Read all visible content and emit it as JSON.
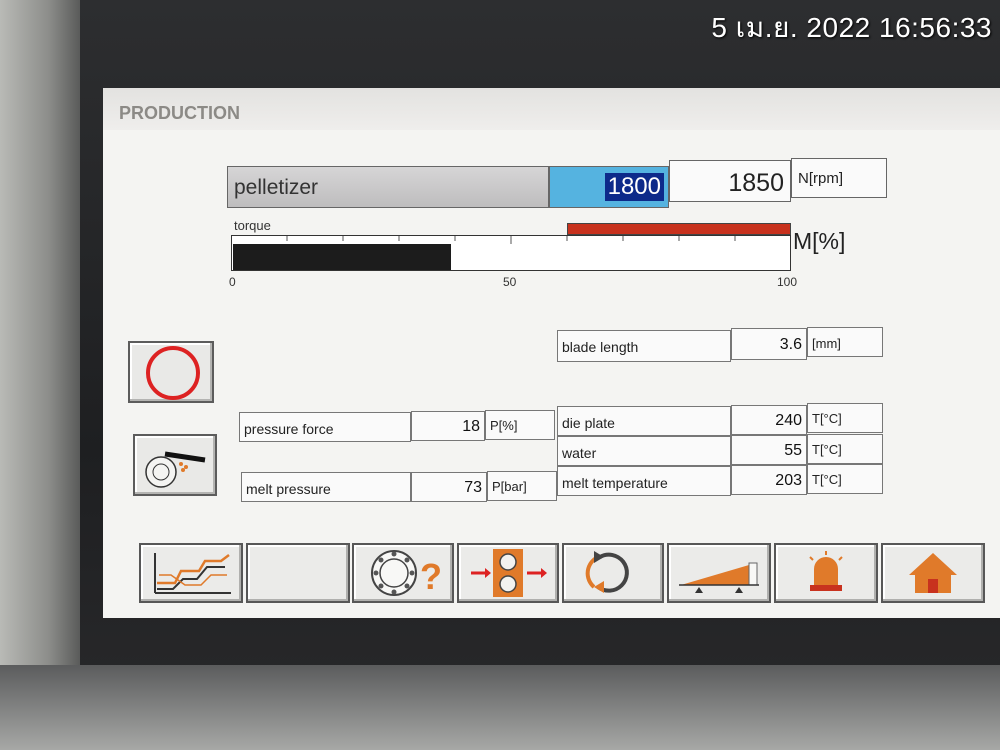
{
  "timestamp": "5 เม.ย. 2022 16:56:33",
  "screen": {
    "title": "PRODUCTION"
  },
  "pelletizer": {
    "label": "pelletizer",
    "setpoint": "1800",
    "actual": "1850",
    "unit": "N[rpm]"
  },
  "torque": {
    "label": "torque",
    "unit": "M[%]",
    "value_percent": 39,
    "limit_from_percent": 60,
    "limit_to_percent": 100,
    "scale": [
      "0",
      "50",
      "100"
    ]
  },
  "readouts": [
    {
      "id": "blade-length",
      "label": "blade length",
      "value": "3.6",
      "unit": "[mm]"
    },
    {
      "id": "pressure-force",
      "label": "pressure force",
      "value": "18",
      "unit": "P[%]"
    },
    {
      "id": "melt-pressure",
      "label": "melt pressure",
      "value": "73",
      "unit": "P[bar]"
    },
    {
      "id": "die-plate",
      "label": "die plate",
      "value": "240",
      "unit": "T[°C]"
    },
    {
      "id": "water",
      "label": "water",
      "value": "55",
      "unit": "T[°C]"
    },
    {
      "id": "melt-temperature",
      "label": "melt temperature",
      "value": "203",
      "unit": "T[°C]"
    }
  ],
  "side_buttons": [
    {
      "icon": "red-ring-icon"
    },
    {
      "icon": "blade-cutter-icon"
    }
  ],
  "toolbar": [
    {
      "icon": "trend-chart-icon"
    },
    {
      "icon": "blank-icon"
    },
    {
      "icon": "bearing-help-icon"
    },
    {
      "icon": "gear-flow-icon"
    },
    {
      "icon": "rotation-icon"
    },
    {
      "icon": "ramp-icon"
    },
    {
      "icon": "alarm-beacon-icon"
    },
    {
      "icon": "home-icon"
    }
  ],
  "colors": {
    "accent_blue": "#55b3e0",
    "selection_navy": "#0d2a8a",
    "alarm_red": "#c8321e",
    "icon_orange": "#e07a2a"
  }
}
